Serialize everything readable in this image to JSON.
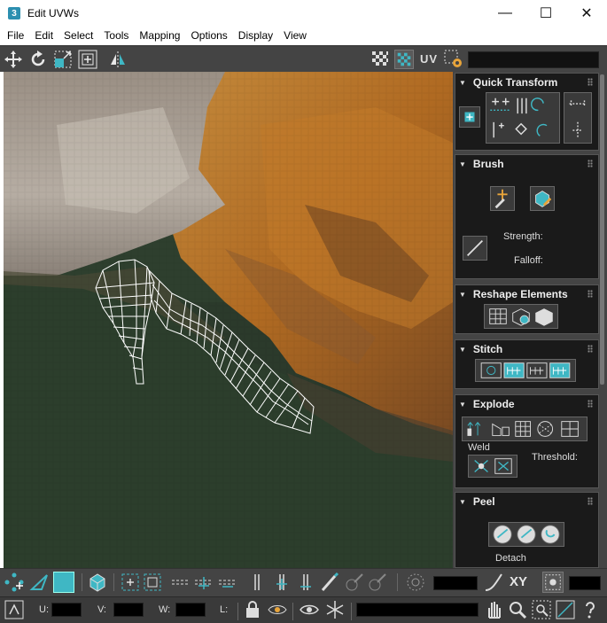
{
  "window": {
    "title": "Edit UVWs",
    "app_icon_text": "3",
    "minimize": "—",
    "maximize": "☐",
    "close": "✕"
  },
  "menu": [
    "File",
    "Edit",
    "Select",
    "Tools",
    "Mapping",
    "Options",
    "Display",
    "View"
  ],
  "toolbar": {
    "uv_label": "UV",
    "icons": [
      "move-icon",
      "rotate-icon",
      "scale-icon",
      "freeform-icon",
      "mirror-icon",
      "checker-pattern-icon",
      "show-map-icon",
      "uv-label-icon",
      "settings-icon"
    ]
  },
  "rollouts": {
    "quick_transform": {
      "title": "Quick Transform"
    },
    "brush": {
      "title": "Brush",
      "strength_label": "Strength:",
      "falloff_label": "Falloff:"
    },
    "reshape_elements": {
      "title": "Reshape Elements"
    },
    "stitch": {
      "title": "Stitch"
    },
    "explode": {
      "title": "Explode",
      "weld_label": "Weld",
      "threshold_label": "Threshold:"
    },
    "peel": {
      "title": "Peel",
      "detach_label": "Detach"
    }
  },
  "bottom": {
    "xy_label": "XY",
    "u_label": "U:",
    "v_label": "V:",
    "w_label": "W:",
    "l_label": "L:"
  },
  "colors": {
    "accent_teal": "#3fb7c4",
    "panel_bg": "#444444",
    "rollout_bg": "#1a1a1a",
    "field_bg": "#000000",
    "wire": "#ffffff"
  }
}
